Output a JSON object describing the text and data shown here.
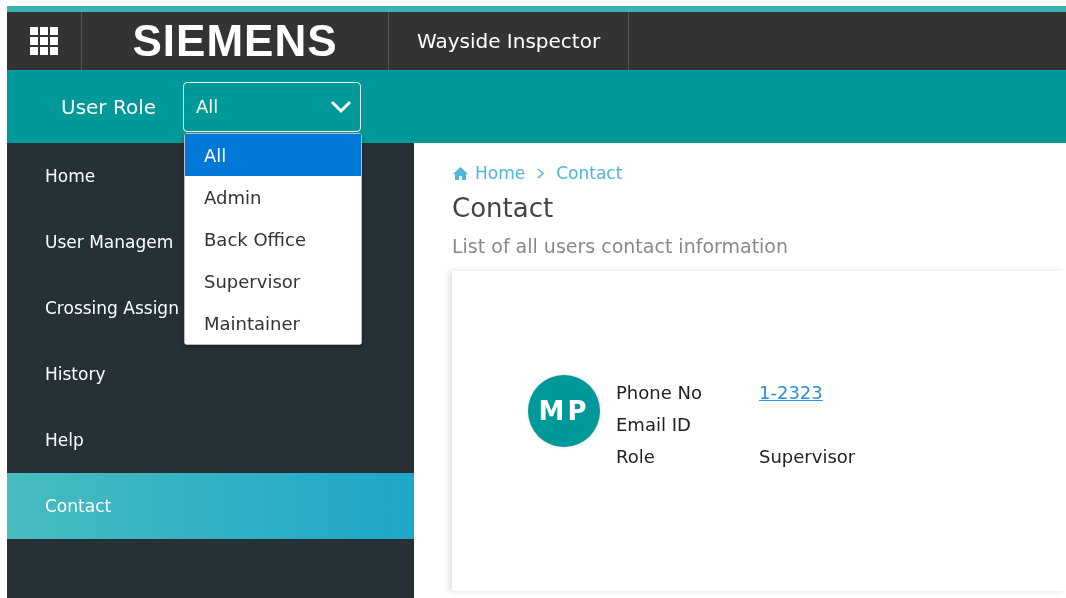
{
  "header": {
    "logo": "SIEMENS",
    "app_title": "Wayside Inspector"
  },
  "role_filter": {
    "label": "User Role",
    "value": "All",
    "expanded": true,
    "options": [
      {
        "label": "All",
        "selected": true
      },
      {
        "label": "Admin",
        "selected": false
      },
      {
        "label": "Back Office",
        "selected": false
      },
      {
        "label": "Supervisor",
        "selected": false
      },
      {
        "label": "Maintainer",
        "selected": false
      }
    ]
  },
  "sidebar": {
    "items": [
      {
        "label": "Home",
        "selected": false
      },
      {
        "label": "User Managem",
        "selected": false
      },
      {
        "label": "Crossing Assign",
        "selected": false
      },
      {
        "label": "History",
        "selected": false
      },
      {
        "label": "Help",
        "selected": false
      },
      {
        "label": "Contact",
        "selected": true
      }
    ]
  },
  "breadcrumb": [
    "Home",
    "Contact"
  ],
  "page": {
    "title": "Contact",
    "subtitle": "List of all users contact information"
  },
  "contact": {
    "initials": "MP",
    "fields": [
      {
        "label": "Phone No",
        "value": "1-2323",
        "kind": "link"
      },
      {
        "label": "Email ID",
        "kind": "empty"
      },
      {
        "label": "Role",
        "value": "Supervisor",
        "kind": "text"
      }
    ]
  }
}
